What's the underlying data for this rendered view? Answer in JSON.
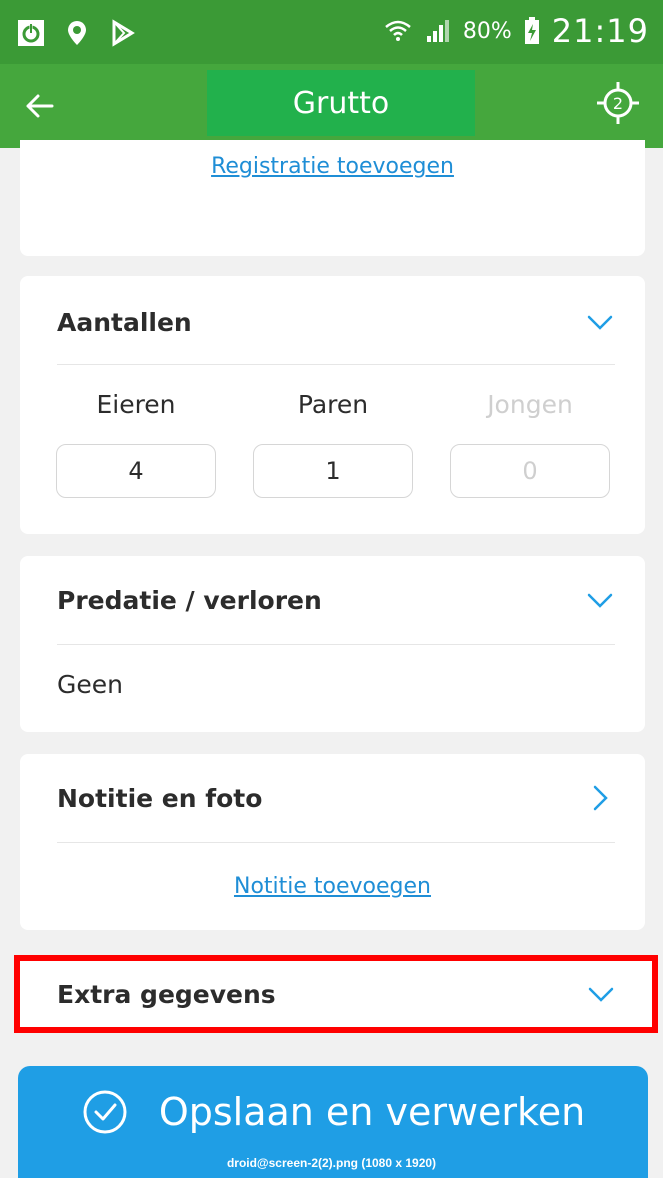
{
  "status_bar": {
    "battery_percent": "80%",
    "time": "21:19",
    "icons": [
      "power-icon",
      "location-icon",
      "play-store-icon",
      "wifi-icon",
      "signal-icon",
      "battery-icon"
    ]
  },
  "app_bar": {
    "title": "Grutto",
    "gps_badge": "2",
    "colors": {
      "bar": "#45a73d",
      "title_highlight": "#22b14c"
    }
  },
  "registration": {
    "add_link": "Registratie toevoegen"
  },
  "counts": {
    "title": "Aantallen",
    "fields": [
      {
        "label": "Eieren",
        "value": "4",
        "enabled": true
      },
      {
        "label": "Paren",
        "value": "1",
        "enabled": true
      },
      {
        "label": "Jongen",
        "value": "0",
        "enabled": false
      }
    ]
  },
  "predation": {
    "title": "Predatie / verloren",
    "value": "Geen"
  },
  "notes": {
    "title": "Notitie en foto",
    "add_link": "Notitie toevoegen"
  },
  "extra": {
    "title": "Extra gegevens"
  },
  "save": {
    "label": "Opslaan en verwerken",
    "caption": "droid@screen-2(2).png (1080 x 1920)"
  }
}
